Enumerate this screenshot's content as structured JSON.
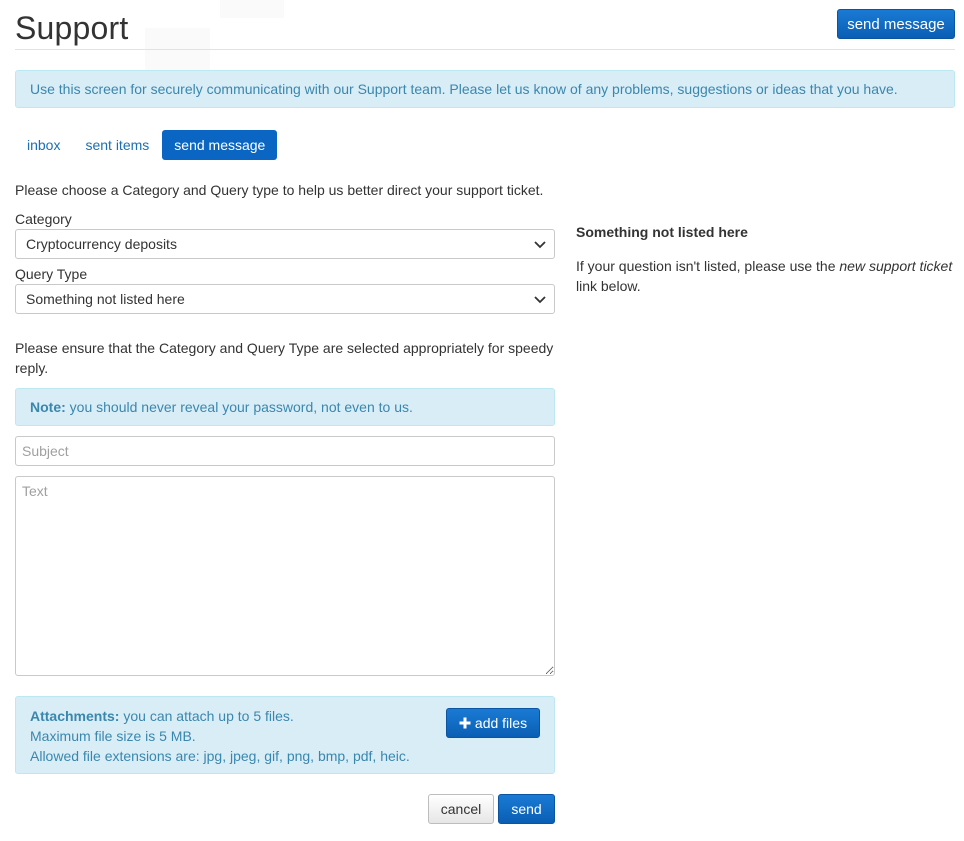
{
  "header": {
    "title": "Support",
    "send_button": "send message"
  },
  "info_banner": "Use this screen for securely communicating with our Support team. Please let us know of any problems, suggestions or ideas that you have.",
  "tabs": [
    {
      "label": "inbox",
      "active": false
    },
    {
      "label": "sent items",
      "active": false
    },
    {
      "label": "send message",
      "active": true
    }
  ],
  "form": {
    "intro": "Please choose a Category and Query type to help us better direct your support ticket.",
    "category_label": "Category",
    "category_value": "Cryptocurrency deposits",
    "query_label": "Query Type",
    "query_value": "Something not listed here",
    "speedy_text": "Please ensure that the Category and Query Type are selected appropriately for speedy reply.",
    "note_bold": "Note:",
    "note_text": " you should never reveal your password, not even to us.",
    "subject_placeholder": "Subject",
    "text_placeholder": "Text",
    "attachments_bold": "Attachments:",
    "attachments_line1": " you can attach up to 5 files.",
    "attachments_line2": "Maximum file size is 5 MB.",
    "attachments_line3": "Allowed file extensions are: jpg, jpeg, gif, png, bmp, pdf, heic.",
    "add_files_label": "add files",
    "add_files_icon": "plus-icon",
    "cancel_label": "cancel",
    "send_label": "send"
  },
  "side_panel": {
    "title": "Something not listed here",
    "text_before": "If your question isn't listed, please use the ",
    "text_link": "new support ticket",
    "text_after": " link below."
  },
  "colors": {
    "primary": "#0a66c2",
    "info_bg": "#d9edf7",
    "info_text": "#3a87ad",
    "link": "#1b6fb5"
  }
}
